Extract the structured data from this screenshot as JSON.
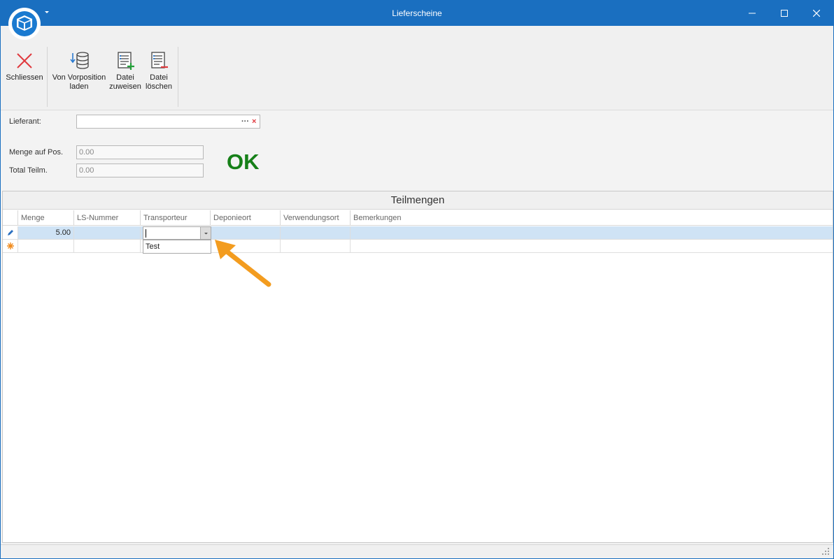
{
  "window": {
    "title": "Lieferscheine",
    "accent_color": "#1a6fc0"
  },
  "ribbon": {
    "buttons": [
      {
        "label_line1": "Schliessen",
        "label_line2": "",
        "icon": "close-x-icon"
      },
      {
        "label_line1": "Von Vorposition",
        "label_line2": "laden",
        "icon": "database-load-icon"
      },
      {
        "label_line1": "Datei",
        "label_line2": "zuweisen",
        "icon": "file-add-icon"
      },
      {
        "label_line1": "Datei",
        "label_line2": "löschen",
        "icon": "file-delete-icon"
      }
    ]
  },
  "form": {
    "lieferant_label": "Lieferant:",
    "lieferant_value": "",
    "menge_label": "Menge auf Pos.",
    "menge_value": "0.00",
    "total_label": "Total Teilm.",
    "total_value": "0.00",
    "status_text": "OK",
    "status_color": "#168018"
  },
  "grid": {
    "caption": "Teilmengen",
    "columns": [
      "Menge",
      "LS-Nummer",
      "Transporteur",
      "Deponieort",
      "Verwendungsort",
      "Bemerkungen"
    ],
    "rows": [
      {
        "state": "editing",
        "menge": "5.00",
        "ls_nummer": "",
        "transporteur": "",
        "deponieort": "",
        "verwendungsort": "",
        "bemerkungen": ""
      },
      {
        "state": "new",
        "menge": "",
        "ls_nummer": "",
        "transporteur": "",
        "deponieort": "",
        "verwendungsort": "",
        "bemerkungen": ""
      }
    ],
    "dropdown_options": [
      "Test"
    ]
  },
  "annotation": {
    "arrow_color": "#f39c1f"
  }
}
